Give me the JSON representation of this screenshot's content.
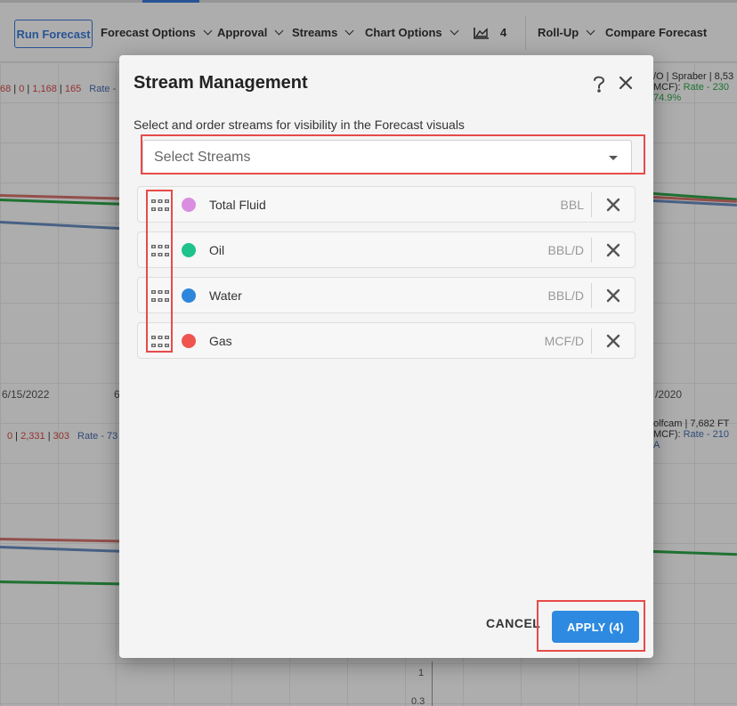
{
  "toolbar": {
    "run_forecast": "Run Forecast",
    "forecast_options": "Forecast Options",
    "approval": "Approval",
    "streams": "Streams",
    "chart_options": "Chart Options",
    "chart_count": "4",
    "roll_up": "Roll-Up",
    "compare_forecast": "Compare Forecast"
  },
  "background": {
    "top_left_header": {
      "a": "68",
      "sep1": " | ",
      "b": "0",
      "sep2": " | ",
      "c": "1,168",
      "sep3": " | ",
      "d": "165",
      "rate": "Rate -"
    },
    "top_right_header": {
      "line1": "/O | Spraber | 8,53",
      "line2": "MCF):",
      "rate": "Rate - 230",
      "line3": "74.9%"
    },
    "date_left": "6/15/2022",
    "date_mid": "6",
    "date_right": "/2020",
    "bottom_left_header": {
      "a": "0",
      "b": "2,331",
      "c": "303",
      "rate": "Rate - 73"
    },
    "bottom_right_header": {
      "line1": "olfcam | 7,682 FT",
      "line2": "MCF):",
      "rate": "Rate - 210",
      "line3": "A"
    },
    "axis_1": "1",
    "axis_03": "0.3"
  },
  "modal": {
    "title": "Stream Management",
    "subtitle": "Select and order streams for visibility in the Forecast visuals",
    "select_placeholder": "Select Streams",
    "streams": [
      {
        "name": "Total Fluid",
        "unit": "BBL",
        "color": "#d98ee0"
      },
      {
        "name": "Oil",
        "unit": "BBL/D",
        "color": "#1fc28a"
      },
      {
        "name": "Water",
        "unit": "BBL/D",
        "color": "#2d86db"
      },
      {
        "name": "Gas",
        "unit": "MCF/D",
        "color": "#f0544f"
      }
    ],
    "cancel": "CANCEL",
    "apply": "APPLY (4)"
  }
}
